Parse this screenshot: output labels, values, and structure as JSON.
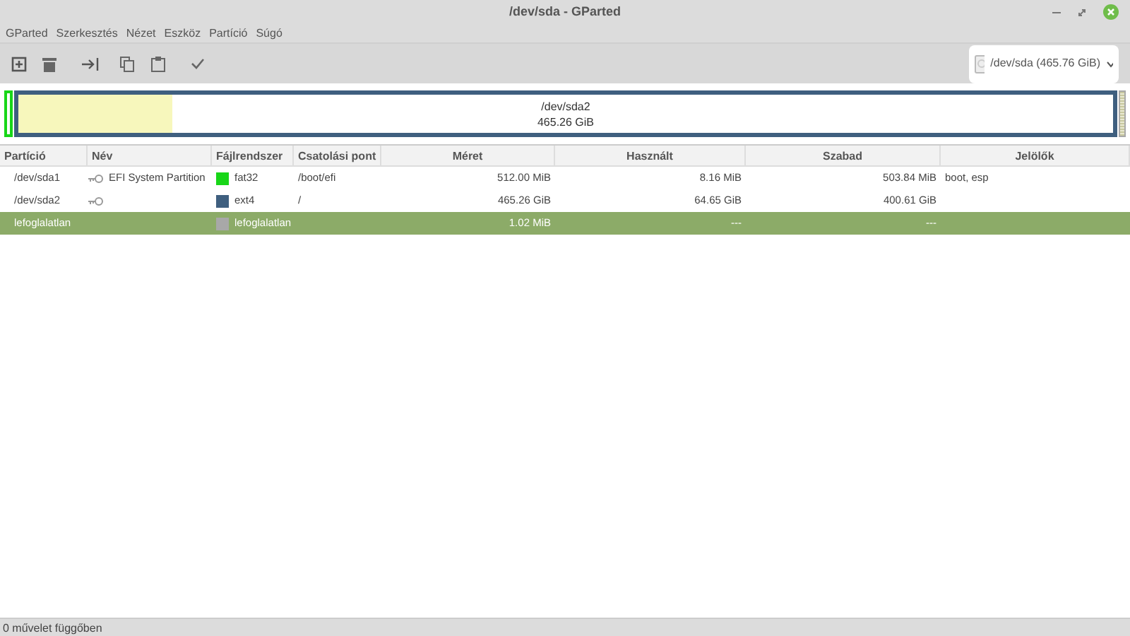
{
  "window": {
    "title": "/dev/sda - GParted"
  },
  "menu": [
    "GParted",
    "Szerkesztés",
    "Nézet",
    "Eszköz",
    "Partíció",
    "Súgó"
  ],
  "device": {
    "label": "/dev/sda",
    "size": "(465.76 GiB)"
  },
  "disk_map": [
    {
      "kind": "small",
      "color": "#18d618"
    },
    {
      "kind": "main",
      "color": "#3f5f7f",
      "label": "/dev/sda2",
      "size": "465.26 GiB",
      "level": 0.14
    },
    {
      "kind": "unallocated",
      "color": "#a8a8a8"
    }
  ],
  "table": {
    "columns": [
      "Partíció",
      "Név",
      "Fájlrendszer",
      "Csatolási pont",
      "Méret",
      "Használt",
      "Szabad",
      "Jelölők"
    ],
    "rows": [
      {
        "partition": "/dev/sda1",
        "mounted": true,
        "name": "EFI System Partition",
        "color": "#18d618",
        "filesystem": "fat32",
        "mount_point": "/boot/efi",
        "size": "512.00 MiB",
        "used": "8.16 MiB",
        "free": "503.84 MiB",
        "flags": "boot, esp",
        "selected": false
      },
      {
        "partition": "/dev/sda2",
        "mounted": true,
        "name": "",
        "color": "#3f5f7f",
        "filesystem": "ext4",
        "mount_point": "/",
        "size": "465.26 GiB",
        "used": "64.65 GiB",
        "free": "400.61 GiB",
        "flags": "",
        "selected": false
      },
      {
        "partition": "lefoglalatlan",
        "mounted": false,
        "name": "",
        "color": "#a8a8a8",
        "filesystem": "lefoglalatlan",
        "mount_point": "",
        "size": "1.02 MiB",
        "used": "---",
        "free": "---",
        "flags": "",
        "selected": true
      }
    ]
  },
  "status_bar": "0 művelet függőben"
}
